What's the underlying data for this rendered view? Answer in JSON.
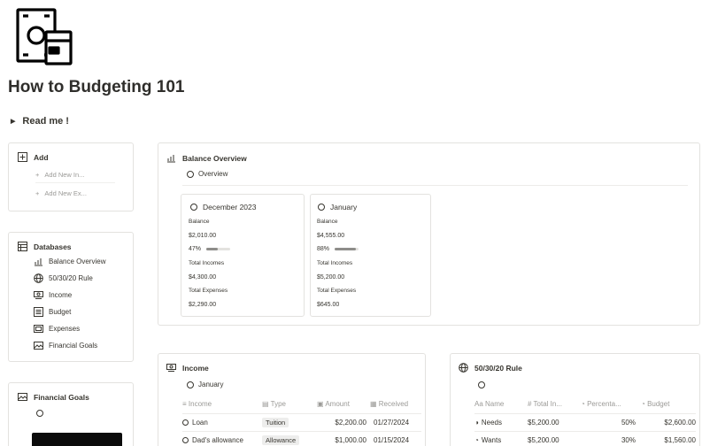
{
  "page": {
    "title": "How to Budgeting 101",
    "toggle_label": "Read me !"
  },
  "add_panel": {
    "title": "Add",
    "buttons": [
      "Add New In...",
      "Add New Ex..."
    ]
  },
  "databases": {
    "title": "Databases",
    "items": [
      {
        "label": "Balance Overview",
        "icon": "chart-icon"
      },
      {
        "label": "50/30/20 Rule",
        "icon": "globe-icon"
      },
      {
        "label": "Income",
        "icon": "money-icon"
      },
      {
        "label": "Budget",
        "icon": "list-icon"
      },
      {
        "label": "Expenses",
        "icon": "receipt-icon"
      },
      {
        "label": "Financial Goals",
        "icon": "picture-icon"
      }
    ]
  },
  "goals_panel": {
    "title": "Financial Goals"
  },
  "balance": {
    "title": "Balance Overview",
    "view_label": "Overview",
    "cards": [
      {
        "month": "December 2023",
        "balance_label": "Balance",
        "balance": "$2,010.00",
        "pct_label": "47%",
        "pct": 0.47,
        "income_label": "Total Incomes",
        "income": "$4,300.00",
        "expense_label": "Total Expenses",
        "expense": "$2,290.00"
      },
      {
        "month": "January",
        "balance_label": "Balance",
        "balance": "$4,555.00",
        "pct_label": "88%",
        "pct": 0.88,
        "income_label": "Total Incomes",
        "income": "$5,200.00",
        "expense_label": "Total Expenses",
        "expense": "$645.00"
      }
    ]
  },
  "income": {
    "title": "Income",
    "view_label": "January",
    "columns": [
      "Income",
      "Type",
      "Amount",
      "Received"
    ],
    "rows": [
      {
        "name": "Loan",
        "type": "Tuition",
        "amount": "$2,200.00",
        "received": "01/27/2024"
      },
      {
        "name": "Dad's allowance",
        "type": "Allowance",
        "amount": "$1,000.00",
        "received": "01/15/2024"
      }
    ]
  },
  "rule": {
    "title": "50/30/20 Rule",
    "columns": [
      "Name",
      "Total In...",
      "Percenta...",
      "Budget"
    ],
    "rows": [
      {
        "name": "Needs",
        "total": "$5,200.00",
        "pct": "50%",
        "budget": "$2,600.00"
      },
      {
        "name": "Wants",
        "total": "$5,200.00",
        "pct": "30%",
        "budget": "$1,560.00"
      }
    ]
  }
}
